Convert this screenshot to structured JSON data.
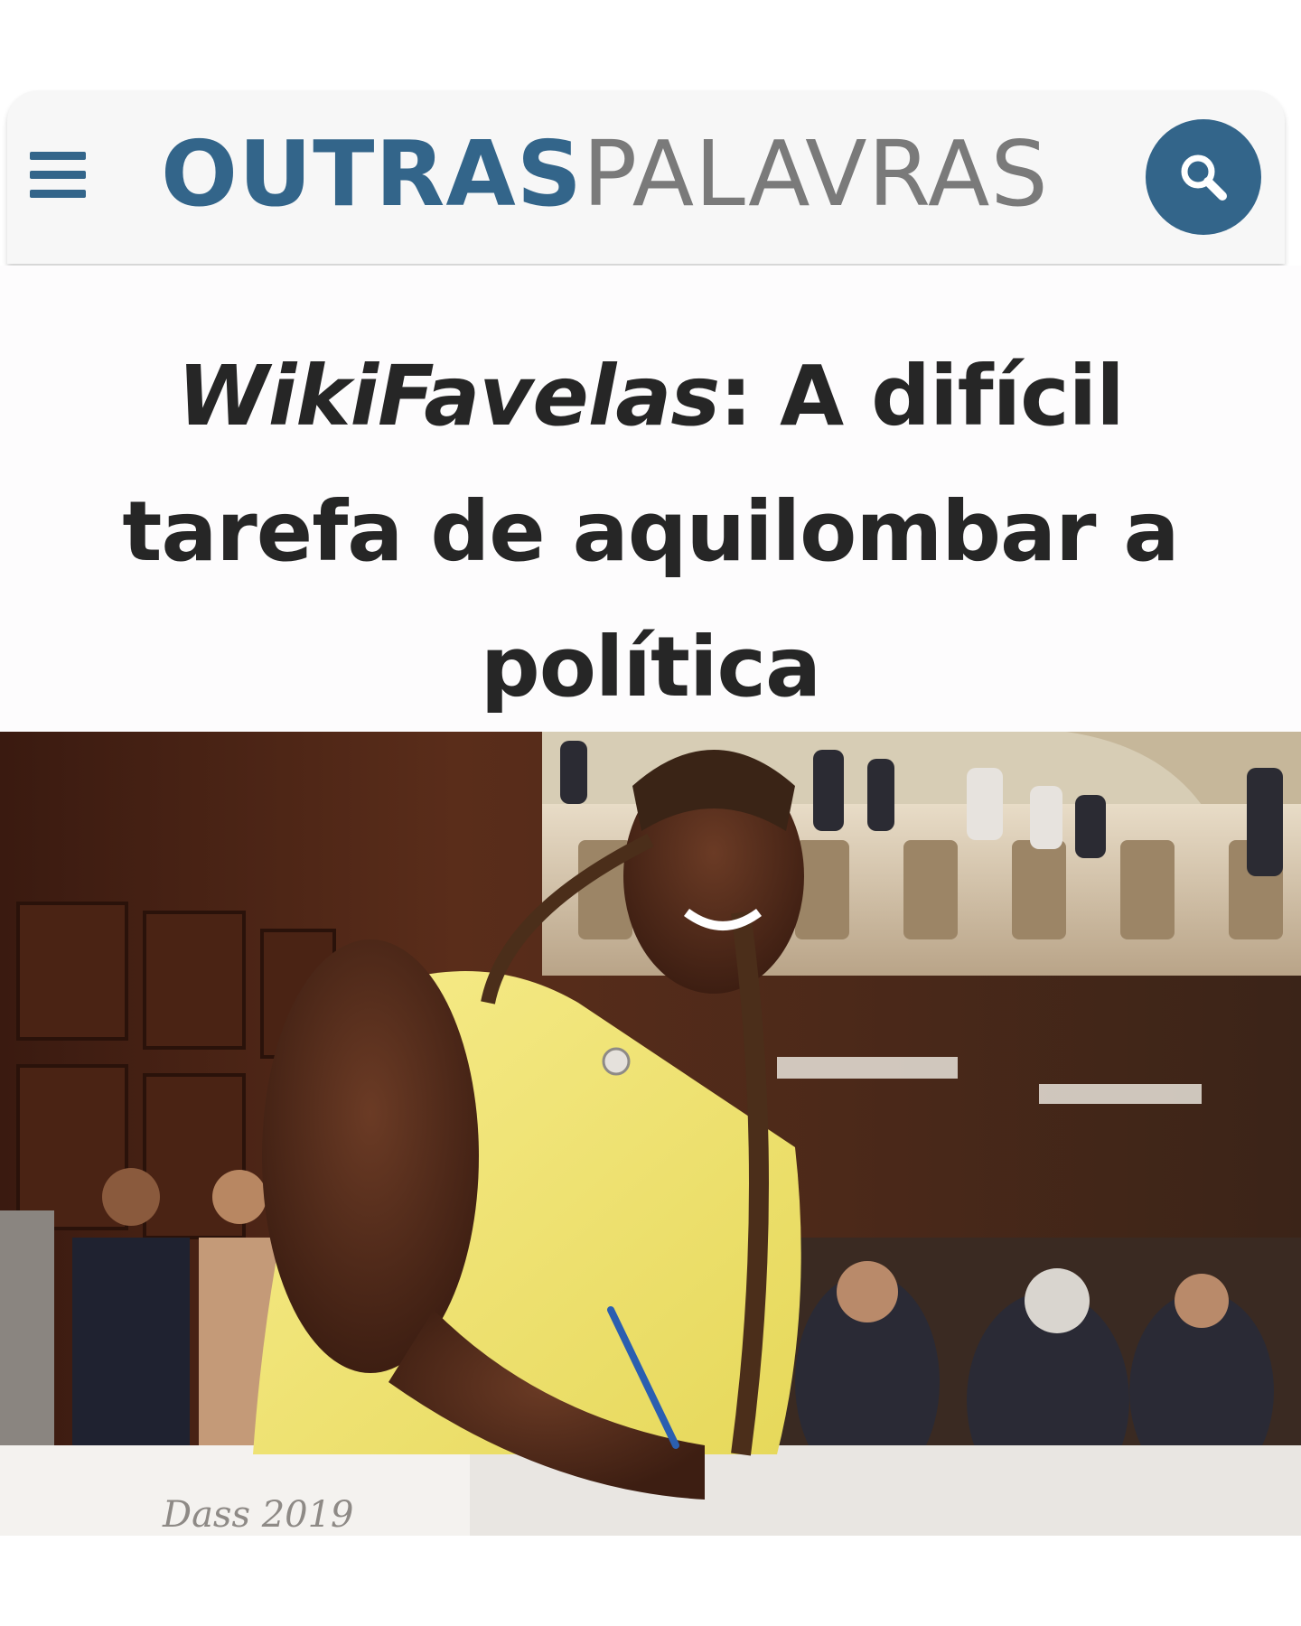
{
  "header": {
    "menu_icon": "hamburger-menu-icon",
    "logo_bold": "OUTRAS",
    "logo_light": "PALAVRAS",
    "search_icon": "search-icon",
    "brand_color": "#33658a"
  },
  "article": {
    "title_italic": "WikiFavelas",
    "title_rest": ": A difícil tarefa de aquilombar a política"
  },
  "photo": {
    "placeholder_text": "Dass 2019"
  }
}
